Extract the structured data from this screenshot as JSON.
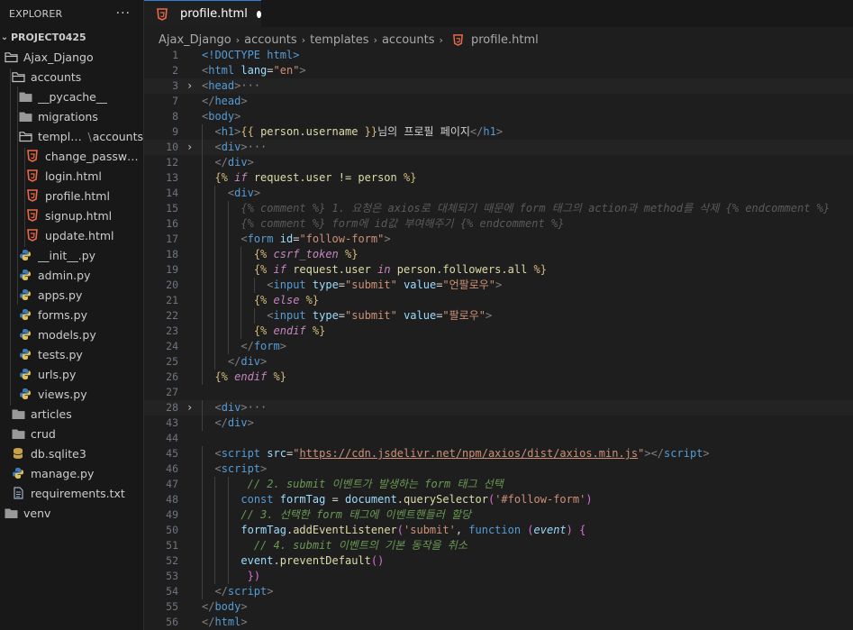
{
  "explorer": {
    "title": "EXPLORER",
    "more": "···",
    "project": "PROJECT0425",
    "items": [
      {
        "label": "Ajax_Django",
        "type": "folder-open",
        "indent": 0
      },
      {
        "label": "accounts",
        "type": "folder-open",
        "indent": 1
      },
      {
        "label": "__pycache__",
        "type": "folder",
        "indent": 2
      },
      {
        "label": "migrations",
        "type": "folder",
        "indent": 2
      },
      {
        "label": "templates",
        "label2": "accounts",
        "type": "folder-open",
        "indent": 2
      },
      {
        "label": "change_passwor...",
        "type": "html",
        "indent": 3
      },
      {
        "label": "login.html",
        "type": "html",
        "indent": 3
      },
      {
        "label": "profile.html",
        "type": "html",
        "indent": 3
      },
      {
        "label": "signup.html",
        "type": "html",
        "indent": 3
      },
      {
        "label": "update.html",
        "type": "html",
        "indent": 3
      },
      {
        "label": "__init__.py",
        "type": "py",
        "indent": 2
      },
      {
        "label": "admin.py",
        "type": "py",
        "indent": 2
      },
      {
        "label": "apps.py",
        "type": "py",
        "indent": 2
      },
      {
        "label": "forms.py",
        "type": "py",
        "indent": 2
      },
      {
        "label": "models.py",
        "type": "py",
        "indent": 2
      },
      {
        "label": "tests.py",
        "type": "py",
        "indent": 2
      },
      {
        "label": "urls.py",
        "type": "py",
        "indent": 2
      },
      {
        "label": "views.py",
        "type": "py",
        "indent": 2
      },
      {
        "label": "articles",
        "type": "folder",
        "indent": 1
      },
      {
        "label": "crud",
        "type": "folder",
        "indent": 1
      },
      {
        "label": "db.sqlite3",
        "type": "db",
        "indent": 1
      },
      {
        "label": "manage.py",
        "type": "py",
        "indent": 1
      },
      {
        "label": "requirements.txt",
        "type": "txt",
        "indent": 1
      },
      {
        "label": "venv",
        "type": "folder",
        "indent": 0
      }
    ]
  },
  "tab": {
    "label": "profile.html",
    "modified": true
  },
  "breadcrumb": [
    "Ajax_Django",
    "accounts",
    "templates",
    "accounts",
    "profile.html"
  ],
  "colors": {
    "html_icon": "#e8684a",
    "py_icon": "#3d7ab8",
    "db_icon": "#c9a04a",
    "folder": "#c5c5c5"
  },
  "code": [
    {
      "n": 1,
      "ind": 0,
      "t": [
        [
          "tag",
          "<!DOCTYPE html"
        ],
        [
          "tag",
          ">"
        ]
      ]
    },
    {
      "n": 2,
      "ind": 0,
      "t": [
        [
          "br",
          "<"
        ],
        [
          "tag",
          "html"
        ],
        [
          "plain",
          " "
        ],
        [
          "attr",
          "lang"
        ],
        [
          "plain",
          "="
        ],
        [
          "str",
          "\"en\""
        ],
        [
          "br",
          ">"
        ]
      ]
    },
    {
      "n": 3,
      "ind": 0,
      "fold": true,
      "hl": true,
      "t": [
        [
          "br",
          "<"
        ],
        [
          "tag",
          "head"
        ],
        [
          "br",
          ">"
        ],
        [
          "ell",
          "···"
        ]
      ]
    },
    {
      "n": 7,
      "ind": 0,
      "t": [
        [
          "br",
          "</"
        ],
        [
          "tag",
          "head"
        ],
        [
          "br",
          ">"
        ]
      ]
    },
    {
      "n": 8,
      "ind": 0,
      "t": [
        [
          "br",
          "<"
        ],
        [
          "tag",
          "body"
        ],
        [
          "br",
          ">"
        ]
      ]
    },
    {
      "n": 9,
      "ind": 1,
      "t": [
        [
          "br",
          "<"
        ],
        [
          "tag",
          "h1"
        ],
        [
          "br",
          ">"
        ],
        [
          "tpl",
          "{{ "
        ],
        [
          "var",
          "person.username"
        ],
        [
          "tpl",
          " }}"
        ],
        [
          "plain",
          "님의 프로필 페이지"
        ],
        [
          "br",
          "</"
        ],
        [
          "tag",
          "h1"
        ],
        [
          "br",
          ">"
        ]
      ]
    },
    {
      "n": 10,
      "ind": 1,
      "fold": true,
      "hl": true,
      "t": [
        [
          "br",
          "<"
        ],
        [
          "tag",
          "div"
        ],
        [
          "br",
          ">"
        ],
        [
          "ell",
          "···"
        ]
      ]
    },
    {
      "n": 12,
      "ind": 1,
      "t": [
        [
          "br",
          "</"
        ],
        [
          "tag",
          "div"
        ],
        [
          "br",
          ">"
        ]
      ]
    },
    {
      "n": 13,
      "ind": 1,
      "t": [
        [
          "tpl",
          "{% "
        ],
        [
          "kw",
          "if"
        ],
        [
          "var",
          " request.user != person "
        ],
        [
          "tpl",
          "%}"
        ]
      ]
    },
    {
      "n": 14,
      "ind": 2,
      "t": [
        [
          "br",
          "<"
        ],
        [
          "tag",
          "div"
        ],
        [
          "br",
          ">"
        ]
      ]
    },
    {
      "n": 15,
      "ind": 3,
      "t": [
        [
          "tcmt",
          "{% comment %} 1. 요청은 axios로 대체되기 때문에 form 태그의 action과 method를 삭제 {% endcomment %}"
        ]
      ]
    },
    {
      "n": 16,
      "ind": 3,
      "t": [
        [
          "tcmt",
          "{% comment %} form에 id값 부여해주기 {% endcomment %}"
        ]
      ]
    },
    {
      "n": 17,
      "ind": 3,
      "t": [
        [
          "br",
          "<"
        ],
        [
          "tag",
          "form"
        ],
        [
          "plain",
          " "
        ],
        [
          "attr",
          "id"
        ],
        [
          "plain",
          "="
        ],
        [
          "str",
          "\"follow-form\""
        ],
        [
          "br",
          ">"
        ]
      ]
    },
    {
      "n": 18,
      "ind": 4,
      "t": [
        [
          "tpl",
          "{% "
        ],
        [
          "kw",
          "csrf_token"
        ],
        [
          "tpl",
          " %}"
        ]
      ]
    },
    {
      "n": 19,
      "ind": 4,
      "t": [
        [
          "tpl",
          "{% "
        ],
        [
          "kw",
          "if"
        ],
        [
          "var",
          " request.user "
        ],
        [
          "kw",
          "in"
        ],
        [
          "var",
          " person.followers.all "
        ],
        [
          "tpl",
          "%}"
        ]
      ]
    },
    {
      "n": 20,
      "ind": 5,
      "t": [
        [
          "br",
          "<"
        ],
        [
          "tag",
          "input"
        ],
        [
          "plain",
          " "
        ],
        [
          "attr",
          "type"
        ],
        [
          "plain",
          "="
        ],
        [
          "str",
          "\"submit\""
        ],
        [
          "plain",
          " "
        ],
        [
          "attr",
          "value"
        ],
        [
          "plain",
          "="
        ],
        [
          "str",
          "\"언팔로우\""
        ],
        [
          "br",
          ">"
        ]
      ]
    },
    {
      "n": 21,
      "ind": 4,
      "t": [
        [
          "tpl",
          "{% "
        ],
        [
          "kw",
          "else"
        ],
        [
          "tpl",
          " %}"
        ]
      ]
    },
    {
      "n": 22,
      "ind": 5,
      "t": [
        [
          "br",
          "<"
        ],
        [
          "tag",
          "input"
        ],
        [
          "plain",
          " "
        ],
        [
          "attr",
          "type"
        ],
        [
          "plain",
          "="
        ],
        [
          "str",
          "\"submit\""
        ],
        [
          "plain",
          " "
        ],
        [
          "attr",
          "value"
        ],
        [
          "plain",
          "="
        ],
        [
          "str",
          "\"팔로우\""
        ],
        [
          "br",
          ">"
        ]
      ]
    },
    {
      "n": 23,
      "ind": 4,
      "t": [
        [
          "tpl",
          "{% "
        ],
        [
          "kw",
          "endif"
        ],
        [
          "tpl",
          " %}"
        ]
      ]
    },
    {
      "n": 24,
      "ind": 3,
      "t": [
        [
          "br",
          "</"
        ],
        [
          "tag",
          "form"
        ],
        [
          "br",
          ">"
        ]
      ]
    },
    {
      "n": 25,
      "ind": 2,
      "t": [
        [
          "br",
          "</"
        ],
        [
          "tag",
          "div"
        ],
        [
          "br",
          ">"
        ]
      ]
    },
    {
      "n": 26,
      "ind": 1,
      "t": [
        [
          "tpl",
          "{% "
        ],
        [
          "kw",
          "endif"
        ],
        [
          "tpl",
          " %}"
        ]
      ]
    },
    {
      "n": 27,
      "ind": 0,
      "t": []
    },
    {
      "n": 28,
      "ind": 1,
      "fold": true,
      "hl": true,
      "t": [
        [
          "br",
          "<"
        ],
        [
          "tag",
          "div"
        ],
        [
          "br",
          ">"
        ],
        [
          "ell",
          "···"
        ]
      ]
    },
    {
      "n": 43,
      "ind": 1,
      "t": [
        [
          "br",
          "</"
        ],
        [
          "tag",
          "div"
        ],
        [
          "br",
          ">"
        ]
      ]
    },
    {
      "n": 44,
      "ind": 0,
      "t": []
    },
    {
      "n": 45,
      "ind": 1,
      "t": [
        [
          "br",
          "<"
        ],
        [
          "tag",
          "script"
        ],
        [
          "plain",
          " "
        ],
        [
          "attr",
          "src"
        ],
        [
          "plain",
          "="
        ],
        [
          "str",
          "\""
        ],
        [
          "url",
          "https://cdn.jsdelivr.net/npm/axios/dist/axios.min.js"
        ],
        [
          "str",
          "\""
        ],
        [
          "br",
          "></"
        ],
        [
          "tag",
          "script"
        ],
        [
          "br",
          ">"
        ]
      ]
    },
    {
      "n": 46,
      "ind": 1,
      "t": [
        [
          "br",
          "<"
        ],
        [
          "tag",
          "script"
        ],
        [
          "br",
          ">"
        ]
      ]
    },
    {
      "n": 47,
      "ind": 3,
      "t": [
        [
          "cmt",
          " // 2. submit 이벤트가 발생하는 form 태그 선택"
        ]
      ]
    },
    {
      "n": 48,
      "ind": 3,
      "t": [
        [
          "jskw",
          "const"
        ],
        [
          "plain",
          " "
        ],
        [
          "jsvar",
          "formTag"
        ],
        [
          "plain",
          " = "
        ],
        [
          "jsvar",
          "document"
        ],
        [
          "plain",
          "."
        ],
        [
          "fn",
          "querySelector"
        ],
        [
          "punc",
          "("
        ],
        [
          "str",
          "'#follow-form'"
        ],
        [
          "punc",
          ")"
        ]
      ]
    },
    {
      "n": 49,
      "ind": 3,
      "t": [
        [
          "cmt",
          "// 3. 선택한 form 태그에 이벤트핸들러 할당"
        ]
      ]
    },
    {
      "n": 50,
      "ind": 3,
      "t": [
        [
          "jsvar",
          "formTag"
        ],
        [
          "plain",
          "."
        ],
        [
          "fn",
          "addEventListener"
        ],
        [
          "punc",
          "("
        ],
        [
          "str",
          "'submit'"
        ],
        [
          "plain",
          ", "
        ],
        [
          "jskw",
          "function"
        ],
        [
          "plain",
          " "
        ],
        [
          "punc",
          "("
        ],
        [
          "param",
          "event"
        ],
        [
          "punc",
          ")"
        ],
        [
          "plain",
          " "
        ],
        [
          "punc",
          "{"
        ]
      ]
    },
    {
      "n": 51,
      "ind": 3,
      "t": [
        [
          "cmt",
          "  // 4. submit 이벤트의 기본 동작을 취소"
        ]
      ]
    },
    {
      "n": 52,
      "ind": 3,
      "t": [
        [
          "jsvar",
          "event"
        ],
        [
          "plain",
          "."
        ],
        [
          "fn",
          "preventDefault"
        ],
        [
          "punc",
          "()"
        ]
      ]
    },
    {
      "n": 53,
      "ind": 3,
      "t": [
        [
          "plain",
          " "
        ],
        [
          "punc",
          "})"
        ]
      ]
    },
    {
      "n": 54,
      "ind": 1,
      "t": [
        [
          "br",
          "</"
        ],
        [
          "tag",
          "script"
        ],
        [
          "br",
          ">"
        ]
      ]
    },
    {
      "n": 55,
      "ind": 0,
      "t": [
        [
          "br",
          "</"
        ],
        [
          "tag",
          "body"
        ],
        [
          "br",
          ">"
        ]
      ]
    },
    {
      "n": 56,
      "ind": 0,
      "t": [
        [
          "br",
          "</"
        ],
        [
          "tag",
          "html"
        ],
        [
          "br",
          ">"
        ]
      ]
    }
  ]
}
